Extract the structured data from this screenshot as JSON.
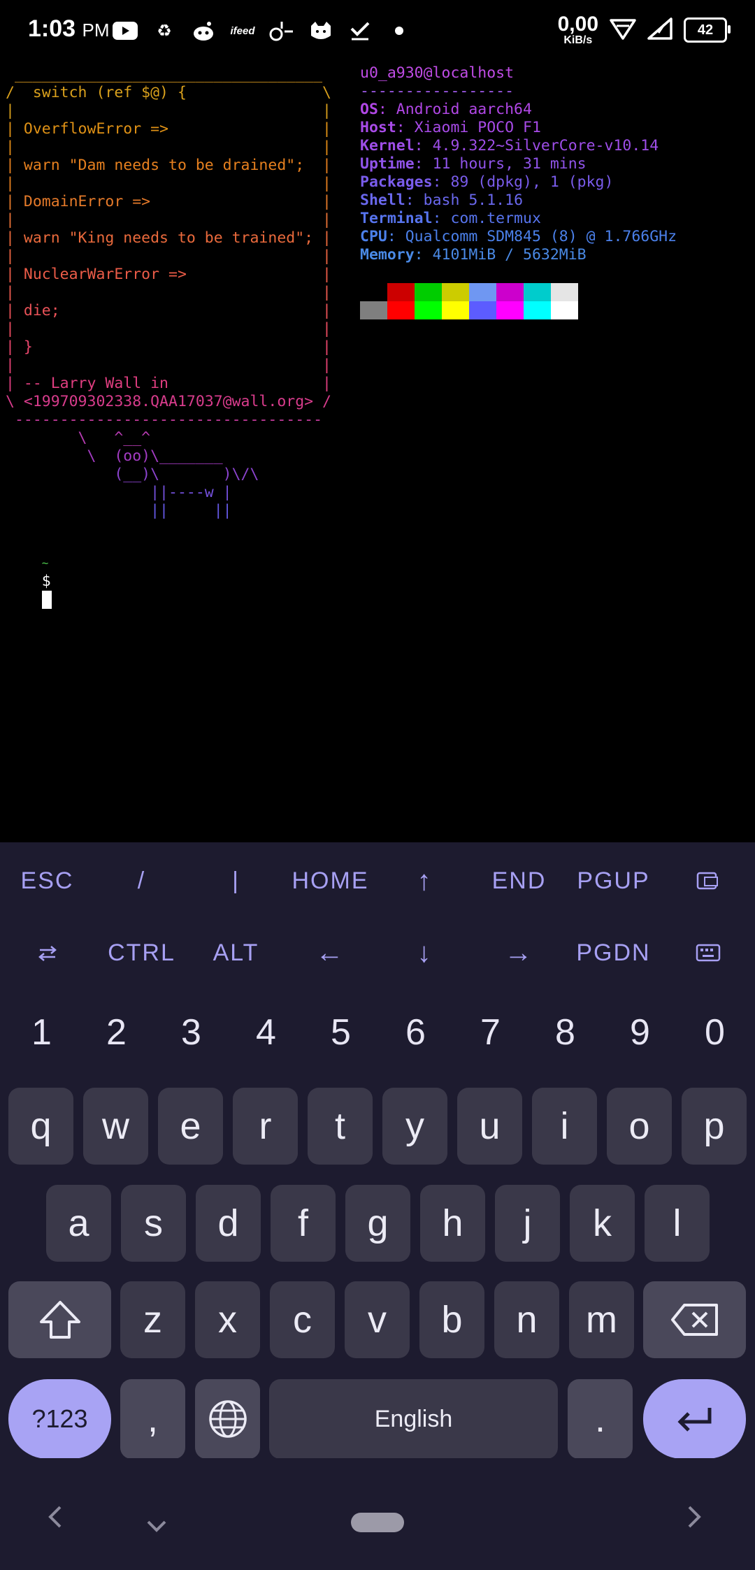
{
  "status_bar": {
    "time": "1:03",
    "ampm": "PM",
    "net_speed_value": "0,00",
    "net_speed_unit": "KiB/s",
    "battery": "42",
    "icons": [
      "youtube-icon",
      "recycle-icon",
      "reddit-icon",
      "ifeed-icon",
      "app-icon",
      "cat-icon",
      "check-icon",
      "dot-icon",
      "wifi-icon",
      "signal-icon",
      "battery-icon"
    ]
  },
  "terminal": {
    "cow_lines": [
      " __________________________________",
      "/  switch (ref $@) {               \\",
      "|                                  |",
      "| OverflowError =>                 |",
      "|                                  |",
      "| warn \"Dam needs to be drained\";  |",
      "|                                  |",
      "| DomainError =>                   |",
      "|                                  |",
      "| warn \"King needs to be trained\"; |",
      "|                                  |",
      "| NuclearWarError =>               |",
      "|                                  |",
      "| die;                             |",
      "|                                  |",
      "| }                                |",
      "|                                  |",
      "| -- Larry Wall in                 |",
      "\\ <199709302338.QAA17037@wall.org> /",
      " ----------------------------------",
      "        \\   ^__^",
      "         \\  (oo)\\_______",
      "            (__)\\       )\\/\\",
      "                ||----w |",
      "                ||     ||"
    ],
    "info_title": "u0_a930@localhost",
    "info_sep": "-----------------",
    "info": [
      {
        "key": "OS",
        "value": "Android aarch64"
      },
      {
        "key": "Host",
        "value": "Xiaomi POCO F1"
      },
      {
        "key": "Kernel",
        "value": "4.9.322~SilverCore-v10.14"
      },
      {
        "key": "Uptime",
        "value": "11 hours, 31 mins"
      },
      {
        "key": "Packages",
        "value": "89 (dpkg), 1 (pkg)"
      },
      {
        "key": "Shell",
        "value": "bash 5.1.16"
      },
      {
        "key": "Terminal",
        "value": "com.termux"
      },
      {
        "key": "CPU",
        "value": "Qualcomm SDM845 (8) @ 1.766GHz"
      },
      {
        "key": "Memory",
        "value": "4101MiB / 5632MiB"
      }
    ],
    "palette_top": [
      "#000000",
      "#cc0000",
      "#00cc00",
      "#cccc00",
      "#6f97f2",
      "#cc00cc",
      "#00cccc",
      "#e5e5e5"
    ],
    "palette_bottom": [
      "#7f7f7f",
      "#ff0000",
      "#00ff00",
      "#ffff00",
      "#5c5cff",
      "#ff00ff",
      "#00ffff",
      "#ffffff"
    ],
    "prompt_tilde": "~",
    "prompt_symbol": "$"
  },
  "extra_keys": {
    "row1": [
      "ESC",
      "/",
      "|",
      "HOME",
      "↑",
      "END",
      "PGUP",
      "paste-icon"
    ],
    "row2": [
      "tab-icon",
      "CTRL",
      "ALT",
      "←",
      "↓",
      "→",
      "PGDN",
      "keyboard-icon"
    ]
  },
  "keyboard": {
    "numbers": [
      "1",
      "2",
      "3",
      "4",
      "5",
      "6",
      "7",
      "8",
      "9",
      "0"
    ],
    "row1": [
      "q",
      "w",
      "e",
      "r",
      "t",
      "y",
      "u",
      "i",
      "o",
      "p"
    ],
    "row2": [
      "a",
      "s",
      "d",
      "f",
      "g",
      "h",
      "j",
      "k",
      "l"
    ],
    "row3": [
      "z",
      "x",
      "c",
      "v",
      "b",
      "n",
      "m"
    ],
    "symbols_key": "?123",
    "comma_key": ",",
    "space_label": "English",
    "period_key": ".",
    "colors": {
      "key_bg": "#3a3849",
      "accent": "#a8a3f4",
      "bg": "#1d1b2f"
    }
  }
}
